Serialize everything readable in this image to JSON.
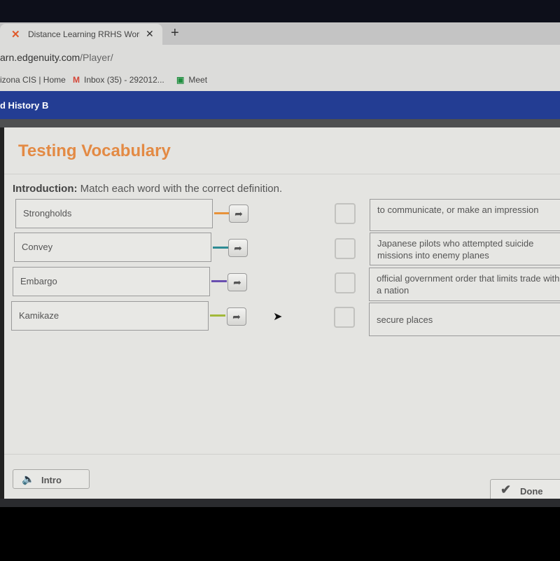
{
  "browser": {
    "tab_title": "Distance Learning RRHS World H",
    "url_domain": "arn.edgenuity.com",
    "url_path": "/Player/",
    "bookmarks": [
      {
        "icon": "",
        "label": "izona CIS | Home"
      },
      {
        "icon": "M",
        "label": "Inbox (35) - 292012..."
      },
      {
        "icon": "▣",
        "label": "Meet"
      }
    ]
  },
  "course": {
    "title": "d History B"
  },
  "activity": {
    "title": "Testing Vocabulary",
    "intro_label": "Introduction:",
    "intro_text": " Match each word with the correct definition.",
    "words": [
      {
        "label": "Strongholds",
        "color": "#e8923a"
      },
      {
        "label": "Convey",
        "color": "#2e8c94"
      },
      {
        "label": "Embargo",
        "color": "#6a4fb0"
      },
      {
        "label": "Kamikaze",
        "color": "#a2b83a"
      }
    ],
    "definitions": [
      "to communicate, or make an impression",
      "Japanese pilots who attempted suicide missions into enemy planes",
      "official government order that limits trade with a nation",
      "secure places"
    ],
    "intro_button": "Intro",
    "done_button": "Done"
  }
}
